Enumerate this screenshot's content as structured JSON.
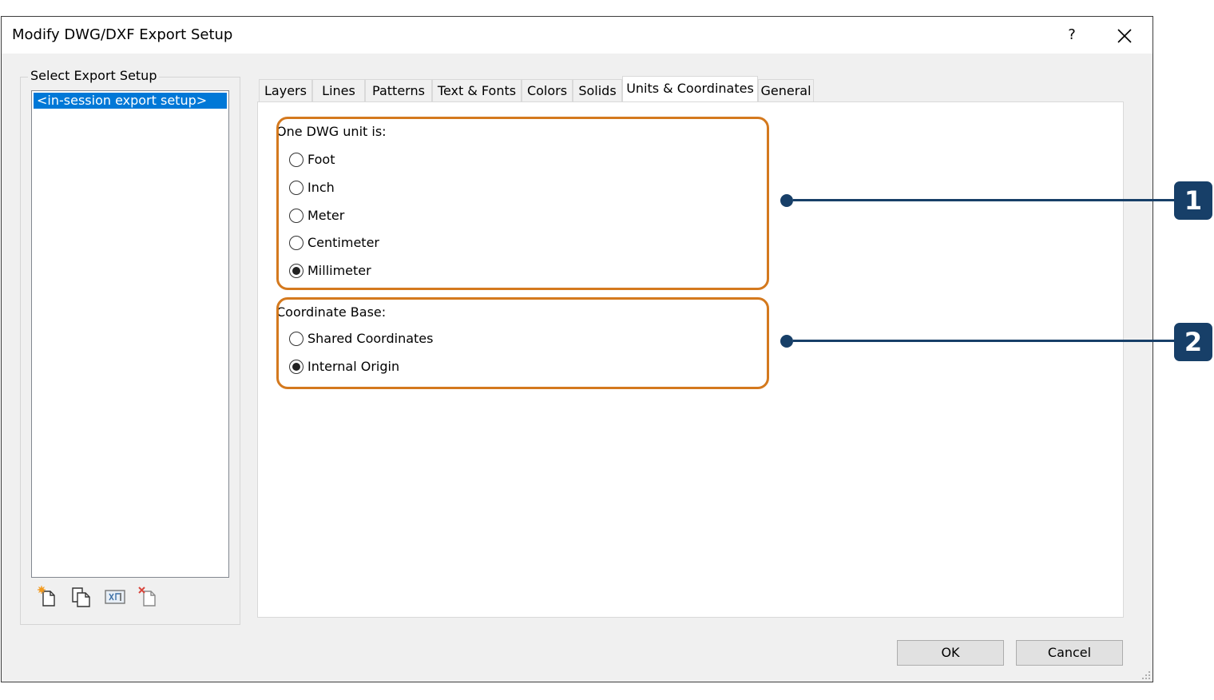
{
  "window": {
    "title": "Modify DWG/DXF Export Setup",
    "help_label": "?"
  },
  "setups": {
    "label": "Select Export Setup",
    "items": [
      "<in-session export setup>"
    ]
  },
  "tabs": [
    {
      "label": "Layers"
    },
    {
      "label": "Lines"
    },
    {
      "label": "Patterns"
    },
    {
      "label": "Text & Fonts"
    },
    {
      "label": "Colors"
    },
    {
      "label": "Solids"
    },
    {
      "label": "Units & Coordinates",
      "active": true
    },
    {
      "label": "General"
    }
  ],
  "units": {
    "label": "One DWG unit is:",
    "options": [
      "Foot",
      "Inch",
      "Meter",
      "Centimeter",
      "Millimeter"
    ],
    "selected": "Millimeter"
  },
  "coordinates": {
    "label": "Coordinate Base:",
    "options": [
      "Shared Coordinates",
      "Internal Origin"
    ],
    "selected": "Internal Origin"
  },
  "callouts": [
    "1",
    "2"
  ],
  "buttons": {
    "ok": "OK",
    "cancel": "Cancel"
  },
  "colors": {
    "highlight": "#d4791e",
    "callout": "#173f68",
    "selection": "#0078d7"
  },
  "icons": [
    "new-setup-icon",
    "duplicate-setup-icon",
    "rename-setup-icon",
    "delete-setup-icon"
  ]
}
